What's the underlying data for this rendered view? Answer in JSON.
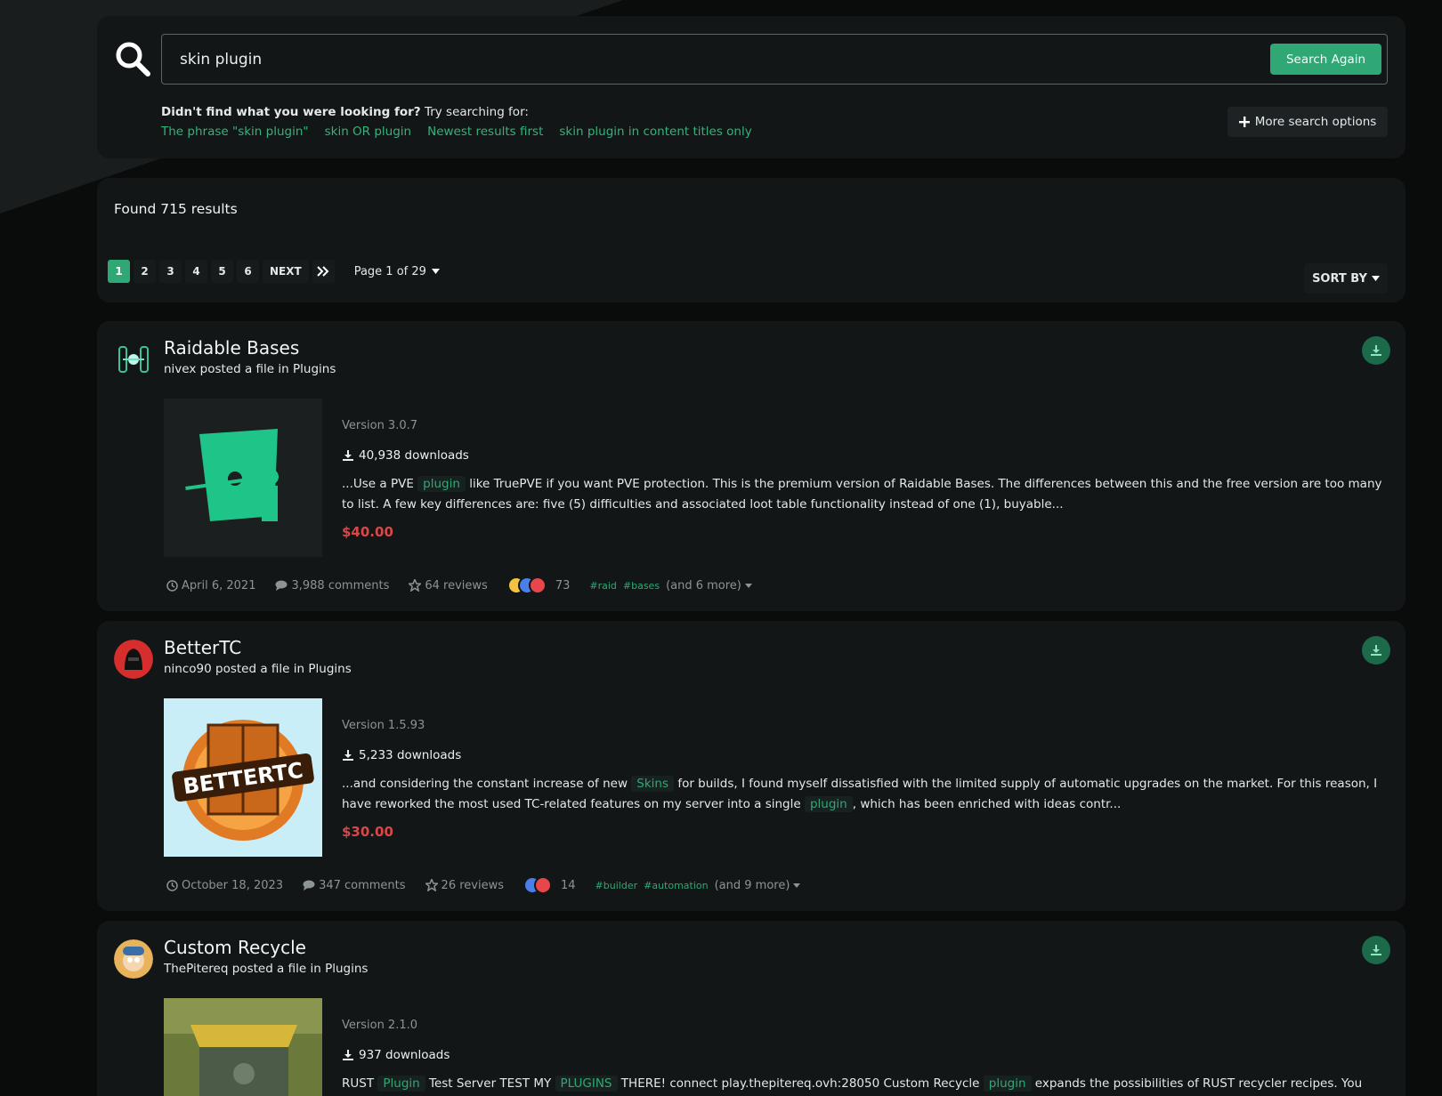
{
  "search": {
    "query": "skin plugin",
    "button_label": "Search Again",
    "suggest_bold": "Didn't find what you were looking for?",
    "suggest_rest": " Try searching for:",
    "suggestions": [
      "The phrase \"skin plugin\"",
      "skin OR plugin",
      "Newest results first",
      "skin plugin in content titles only"
    ],
    "more_options_label": "More search options"
  },
  "results": {
    "found_text": "Found 715 results",
    "pages": [
      "1",
      "2",
      "3",
      "4",
      "5",
      "6"
    ],
    "active_page": "1",
    "next_label": "NEXT",
    "page_of": "Page 1 of 29",
    "sort_label": "SORT BY"
  },
  "items": [
    {
      "title": "Raidable Bases",
      "author": "nivex",
      "posted_text": "posted a file in",
      "category": "Plugins",
      "version": "Version 3.0.7",
      "downloads": "40,938 downloads",
      "snippet_parts": [
        {
          "t": "...Use a PVE ",
          "hl": false
        },
        {
          "t": "plugin",
          "hl": true
        },
        {
          "t": " like TruePVE if you want PVE protection. This is the premium version of Raidable Bases. The differences between this and the free version are too many to list. A few key differences are: five (5) difficulties and associated loot table functionality instead of one (1), buyable...",
          "hl": false
        }
      ],
      "price": "$40.00",
      "date": "April 6, 2021",
      "comments": "3,988 comments",
      "reviews": "64 reviews",
      "reaction_count": "73",
      "tags": [
        "#raid",
        "#bases"
      ],
      "more_tags": "(and 6 more)"
    },
    {
      "title": "BetterTC",
      "author": "ninco90",
      "posted_text": "posted a file in",
      "category": "Plugins",
      "version": "Version 1.5.93",
      "downloads": "5,233 downloads",
      "snippet_parts": [
        {
          "t": "...and considering the constant increase of new ",
          "hl": false
        },
        {
          "t": "Skins",
          "hl": true
        },
        {
          "t": " for builds, I found myself dissatisfied with the limited supply of automatic upgrades on the market. For this reason, I have reworked the most used TC-related features on my server into a single ",
          "hl": false
        },
        {
          "t": "plugin",
          "hl": true
        },
        {
          "t": ", which has been enriched with ideas contr...",
          "hl": false
        }
      ],
      "price": "$30.00",
      "date": "October 18, 2023",
      "comments": "347 comments",
      "reviews": "26 reviews",
      "reaction_count": "14",
      "tags": [
        "#builder",
        "#automation"
      ],
      "more_tags": "(and 9 more)"
    },
    {
      "title": "Custom Recycle",
      "author": "ThePitereq",
      "posted_text": "posted a file in",
      "category": "Plugins",
      "version": "Version 2.1.0",
      "downloads": "937 downloads",
      "snippet_parts": [
        {
          "t": "RUST ",
          "hl": false
        },
        {
          "t": "Plugin",
          "hl": true
        },
        {
          "t": " Test Server TEST MY ",
          "hl": false
        },
        {
          "t": "PLUGINS",
          "hl": true
        },
        {
          "t": " THERE! connect play.thepitereq.ovh:28050 Custom Recycle ",
          "hl": false
        },
        {
          "t": "plugin",
          "hl": true
        },
        {
          "t": " expands the possibilities of RUST recycler recipes. You can",
          "hl": false
        }
      ]
    }
  ],
  "colors": {
    "accent": "#2fa876",
    "price": "#d94848",
    "panel": "#121617",
    "background": "#0a0c0c"
  }
}
